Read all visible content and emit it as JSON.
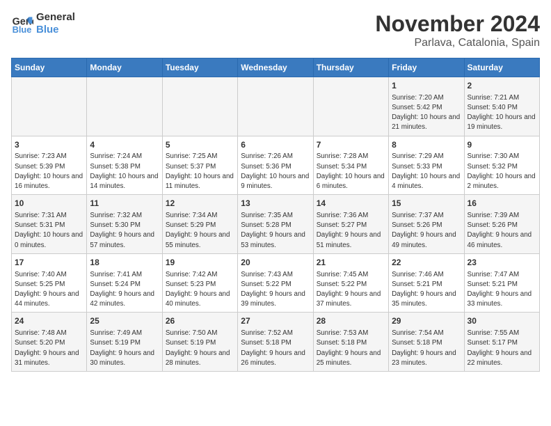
{
  "logo": {
    "line1": "General",
    "line2": "Blue"
  },
  "title": "November 2024",
  "location": "Parlava, Catalonia, Spain",
  "weekdays": [
    "Sunday",
    "Monday",
    "Tuesday",
    "Wednesday",
    "Thursday",
    "Friday",
    "Saturday"
  ],
  "weeks": [
    [
      {
        "day": "",
        "info": ""
      },
      {
        "day": "",
        "info": ""
      },
      {
        "day": "",
        "info": ""
      },
      {
        "day": "",
        "info": ""
      },
      {
        "day": "",
        "info": ""
      },
      {
        "day": "1",
        "info": "Sunrise: 7:20 AM\nSunset: 5:42 PM\nDaylight: 10 hours and 21 minutes."
      },
      {
        "day": "2",
        "info": "Sunrise: 7:21 AM\nSunset: 5:40 PM\nDaylight: 10 hours and 19 minutes."
      }
    ],
    [
      {
        "day": "3",
        "info": "Sunrise: 7:23 AM\nSunset: 5:39 PM\nDaylight: 10 hours and 16 minutes."
      },
      {
        "day": "4",
        "info": "Sunrise: 7:24 AM\nSunset: 5:38 PM\nDaylight: 10 hours and 14 minutes."
      },
      {
        "day": "5",
        "info": "Sunrise: 7:25 AM\nSunset: 5:37 PM\nDaylight: 10 hours and 11 minutes."
      },
      {
        "day": "6",
        "info": "Sunrise: 7:26 AM\nSunset: 5:36 PM\nDaylight: 10 hours and 9 minutes."
      },
      {
        "day": "7",
        "info": "Sunrise: 7:28 AM\nSunset: 5:34 PM\nDaylight: 10 hours and 6 minutes."
      },
      {
        "day": "8",
        "info": "Sunrise: 7:29 AM\nSunset: 5:33 PM\nDaylight: 10 hours and 4 minutes."
      },
      {
        "day": "9",
        "info": "Sunrise: 7:30 AM\nSunset: 5:32 PM\nDaylight: 10 hours and 2 minutes."
      }
    ],
    [
      {
        "day": "10",
        "info": "Sunrise: 7:31 AM\nSunset: 5:31 PM\nDaylight: 10 hours and 0 minutes."
      },
      {
        "day": "11",
        "info": "Sunrise: 7:32 AM\nSunset: 5:30 PM\nDaylight: 9 hours and 57 minutes."
      },
      {
        "day": "12",
        "info": "Sunrise: 7:34 AM\nSunset: 5:29 PM\nDaylight: 9 hours and 55 minutes."
      },
      {
        "day": "13",
        "info": "Sunrise: 7:35 AM\nSunset: 5:28 PM\nDaylight: 9 hours and 53 minutes."
      },
      {
        "day": "14",
        "info": "Sunrise: 7:36 AM\nSunset: 5:27 PM\nDaylight: 9 hours and 51 minutes."
      },
      {
        "day": "15",
        "info": "Sunrise: 7:37 AM\nSunset: 5:26 PM\nDaylight: 9 hours and 49 minutes."
      },
      {
        "day": "16",
        "info": "Sunrise: 7:39 AM\nSunset: 5:26 PM\nDaylight: 9 hours and 46 minutes."
      }
    ],
    [
      {
        "day": "17",
        "info": "Sunrise: 7:40 AM\nSunset: 5:25 PM\nDaylight: 9 hours and 44 minutes."
      },
      {
        "day": "18",
        "info": "Sunrise: 7:41 AM\nSunset: 5:24 PM\nDaylight: 9 hours and 42 minutes."
      },
      {
        "day": "19",
        "info": "Sunrise: 7:42 AM\nSunset: 5:23 PM\nDaylight: 9 hours and 40 minutes."
      },
      {
        "day": "20",
        "info": "Sunrise: 7:43 AM\nSunset: 5:22 PM\nDaylight: 9 hours and 39 minutes."
      },
      {
        "day": "21",
        "info": "Sunrise: 7:45 AM\nSunset: 5:22 PM\nDaylight: 9 hours and 37 minutes."
      },
      {
        "day": "22",
        "info": "Sunrise: 7:46 AM\nSunset: 5:21 PM\nDaylight: 9 hours and 35 minutes."
      },
      {
        "day": "23",
        "info": "Sunrise: 7:47 AM\nSunset: 5:21 PM\nDaylight: 9 hours and 33 minutes."
      }
    ],
    [
      {
        "day": "24",
        "info": "Sunrise: 7:48 AM\nSunset: 5:20 PM\nDaylight: 9 hours and 31 minutes."
      },
      {
        "day": "25",
        "info": "Sunrise: 7:49 AM\nSunset: 5:19 PM\nDaylight: 9 hours and 30 minutes."
      },
      {
        "day": "26",
        "info": "Sunrise: 7:50 AM\nSunset: 5:19 PM\nDaylight: 9 hours and 28 minutes."
      },
      {
        "day": "27",
        "info": "Sunrise: 7:52 AM\nSunset: 5:18 PM\nDaylight: 9 hours and 26 minutes."
      },
      {
        "day": "28",
        "info": "Sunrise: 7:53 AM\nSunset: 5:18 PM\nDaylight: 9 hours and 25 minutes."
      },
      {
        "day": "29",
        "info": "Sunrise: 7:54 AM\nSunset: 5:18 PM\nDaylight: 9 hours and 23 minutes."
      },
      {
        "day": "30",
        "info": "Sunrise: 7:55 AM\nSunset: 5:17 PM\nDaylight: 9 hours and 22 minutes."
      }
    ]
  ]
}
